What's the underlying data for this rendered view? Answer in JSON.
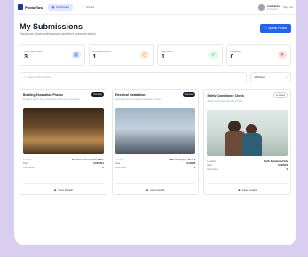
{
  "app": {
    "name": "PhotoFlow"
  },
  "nav": {
    "tabs": [
      {
        "label": "Dashboard",
        "icon": "grid-icon",
        "active": true
      },
      {
        "label": "Upload",
        "icon": "upload-icon",
        "active": false
      }
    ],
    "user": {
      "name": "contractor",
      "role": "Contractor",
      "signout": "Sign out"
    }
  },
  "header": {
    "title": "My Submissions",
    "subtitle": "Track your photo submissions and their approval status",
    "upload_button": "Upload Photos"
  },
  "stats": [
    {
      "label": "Total submissions",
      "value": "3",
      "icon": "document-icon",
      "color": "#2563eb",
      "bg": "#dbeafe",
      "glyph": "▤"
    },
    {
      "label": "Pending Review",
      "value": "1",
      "icon": "clock-icon",
      "color": "#f97316",
      "bg": "#ffedd5",
      "glyph": "◷"
    },
    {
      "label": "Approved",
      "value": "1",
      "icon": "check-circle-icon",
      "color": "#16a34a",
      "bg": "#dcfce7",
      "glyph": "✓"
    },
    {
      "label": "Rejected",
      "value": "0",
      "icon": "x-circle-icon",
      "color": "#dc2626",
      "bg": "#fee2e2",
      "glyph": "✕"
    }
  ],
  "filter": {
    "search_placeholder": "Search submissions...",
    "status_value": "All Status"
  },
  "cards": [
    {
      "title": "Building Excavation Photos",
      "badge": "Pending",
      "badge_style": "dark",
      "description": "Progress photos of the excavation work for the foundation",
      "photo": "p1",
      "rows": [
        {
          "k": "Location",
          "v": "Downtown Construction Site"
        },
        {
          "k": "Date",
          "v": "1/15/2024"
        },
        {
          "k": "Comments",
          "v": "0"
        }
      ],
      "action": "View Details"
    },
    {
      "title": "Electrical Installation",
      "badge": "Approved",
      "badge_style": "dark",
      "description": "Electrical panel and wiring installation on floor 2",
      "photo": "p2",
      "rows": [
        {
          "k": "Location",
          "v": "Office Complex - Floor 2"
        },
        {
          "k": "Date",
          "v": "1/14/2024"
        },
        {
          "k": "Comments",
          "v": "1"
        }
      ],
      "action": "View Details"
    },
    {
      "title": "Safety Compliance Check",
      "badge": "In review",
      "badge_style": "outline",
      "description": "Safety equipment inspection photos",
      "photo": "p3",
      "rows": [
        {
          "k": "Location",
          "v": "North Residential Site"
        },
        {
          "k": "Date",
          "v": "1/13/2024"
        },
        {
          "k": "Comments",
          "v": "0"
        }
      ],
      "action": "View Details"
    }
  ]
}
